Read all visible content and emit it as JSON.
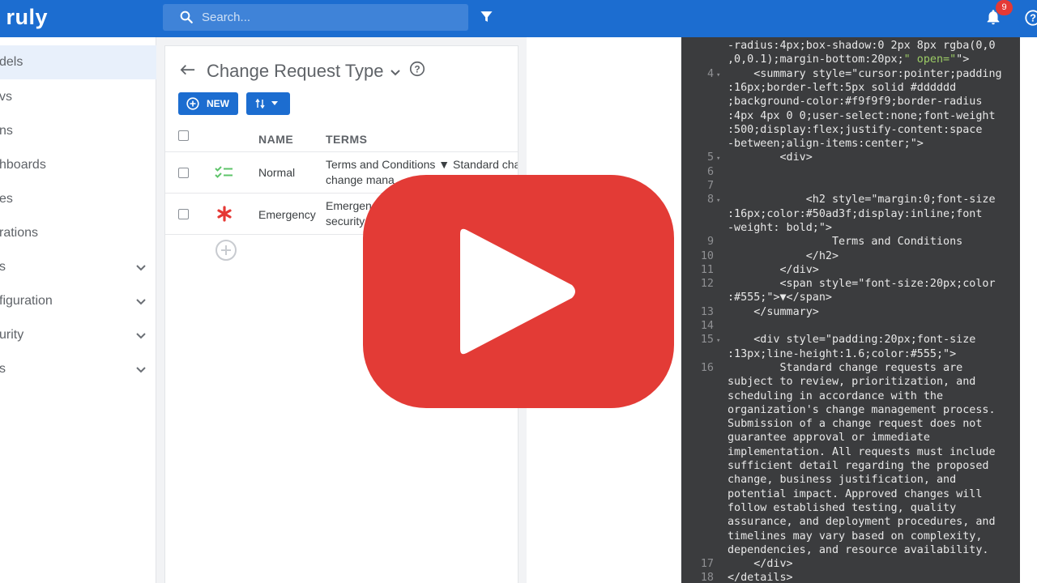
{
  "app": {
    "logo": "ruly"
  },
  "search": {
    "placeholder": "Search..."
  },
  "notifications": {
    "count": "9"
  },
  "sidebar": {
    "items": [
      {
        "label": "dels",
        "active": true,
        "expandable": false
      },
      {
        "label": "vs",
        "expandable": false
      },
      {
        "label": "ns",
        "expandable": false
      },
      {
        "label": "hboards",
        "expandable": false
      },
      {
        "label": "es",
        "expandable": false
      },
      {
        "label": "rations",
        "expandable": false
      },
      {
        "label": "s",
        "expandable": true
      },
      {
        "label": "figuration",
        "expandable": true
      },
      {
        "label": "urity",
        "expandable": true
      },
      {
        "label": "s",
        "expandable": true
      }
    ]
  },
  "panel": {
    "title": "Change Request Type",
    "new_label": "NEW",
    "columns": {
      "name": "NAME",
      "terms": "TERMS"
    },
    "rows": [
      {
        "icon": "checklist-icon",
        "name": "Normal",
        "terms_line1": "Terms and Conditions ▼ Standard cha",
        "terms_line2": "change mana"
      },
      {
        "icon": "asterisk-icon",
        "name": "Emergency",
        "terms_line1": "Emergen",
        "terms_line2": "security"
      }
    ]
  },
  "editor": {
    "lines": [
      {
        "n": "",
        "text": "-radius:4px;box-shadow:0 2px 8px rgba(0,0"
      },
      {
        "n": "",
        "text": ",0,0.1);margin-bottom:20px;\" open=\"\">"
      },
      {
        "n": "4",
        "text": "    <summary style=\"cursor:pointer;padding"
      },
      {
        "n": "",
        "text": ":16px;border-left:5px solid #dddddd"
      },
      {
        "n": "",
        "text": ";background-color:#f9f9f9;border-radius"
      },
      {
        "n": "",
        "text": ":4px 4px 0 0;user-select:none;font-weight"
      },
      {
        "n": "",
        "text": ":500;display:flex;justify-content:space"
      },
      {
        "n": "",
        "text": "-between;align-items:center;\">"
      },
      {
        "n": "5",
        "text": "        <div>"
      },
      {
        "n": "6",
        "text": ""
      },
      {
        "n": "7",
        "text": ""
      },
      {
        "n": "8",
        "text": "            <h2 style=\"margin:0;font-size"
      },
      {
        "n": "",
        "text": ":16px;color:#50ad3f;display:inline;font"
      },
      {
        "n": "",
        "text": "-weight: bold;\">"
      },
      {
        "n": "9",
        "text": "                Terms and Conditions"
      },
      {
        "n": "10",
        "text": "            </h2>"
      },
      {
        "n": "11",
        "text": "        </div>"
      },
      {
        "n": "12",
        "text": "        <span style=\"font-size:20px;color"
      },
      {
        "n": "",
        "text": ":#555;\">▼</span>"
      },
      {
        "n": "13",
        "text": "    </summary>"
      },
      {
        "n": "14",
        "text": ""
      },
      {
        "n": "15",
        "text": "    <div style=\"padding:20px;font-size"
      },
      {
        "n": "",
        "text": ":13px;line-height:1.6;color:#555;\">"
      },
      {
        "n": "16",
        "text": "        Standard change requests are"
      },
      {
        "n": "",
        "text": "subject to review, prioritization, and"
      },
      {
        "n": "",
        "text": "scheduling in accordance with the"
      },
      {
        "n": "",
        "text": "organization's change management process."
      },
      {
        "n": "",
        "text": "Submission of a change request does not"
      },
      {
        "n": "",
        "text": "guarantee approval or immediate"
      },
      {
        "n": "",
        "text": "implementation. All requests must include"
      },
      {
        "n": "",
        "text": "sufficient detail regarding the proposed"
      },
      {
        "n": "",
        "text": "change, business justification, and"
      },
      {
        "n": "",
        "text": "potential impact. Approved changes will"
      },
      {
        "n": "",
        "text": "follow established testing, quality"
      },
      {
        "n": "",
        "text": "assurance, and deployment procedures, and"
      },
      {
        "n": "",
        "text": "timelines may vary based on complexity,"
      },
      {
        "n": "",
        "text": "dependencies, and resource availability."
      },
      {
        "n": "17",
        "text": "    </div>"
      },
      {
        "n": "18",
        "text": "</details>"
      }
    ],
    "fold_lines": [
      "4",
      "5",
      "8",
      "15"
    ]
  },
  "colors": {
    "brand": "#1c6dd0",
    "play": "#e53935",
    "emergency": "#e53935",
    "normal_icon": "#5ec46a",
    "code_bg": "#3b3c3e",
    "string": "#9ccc65"
  }
}
